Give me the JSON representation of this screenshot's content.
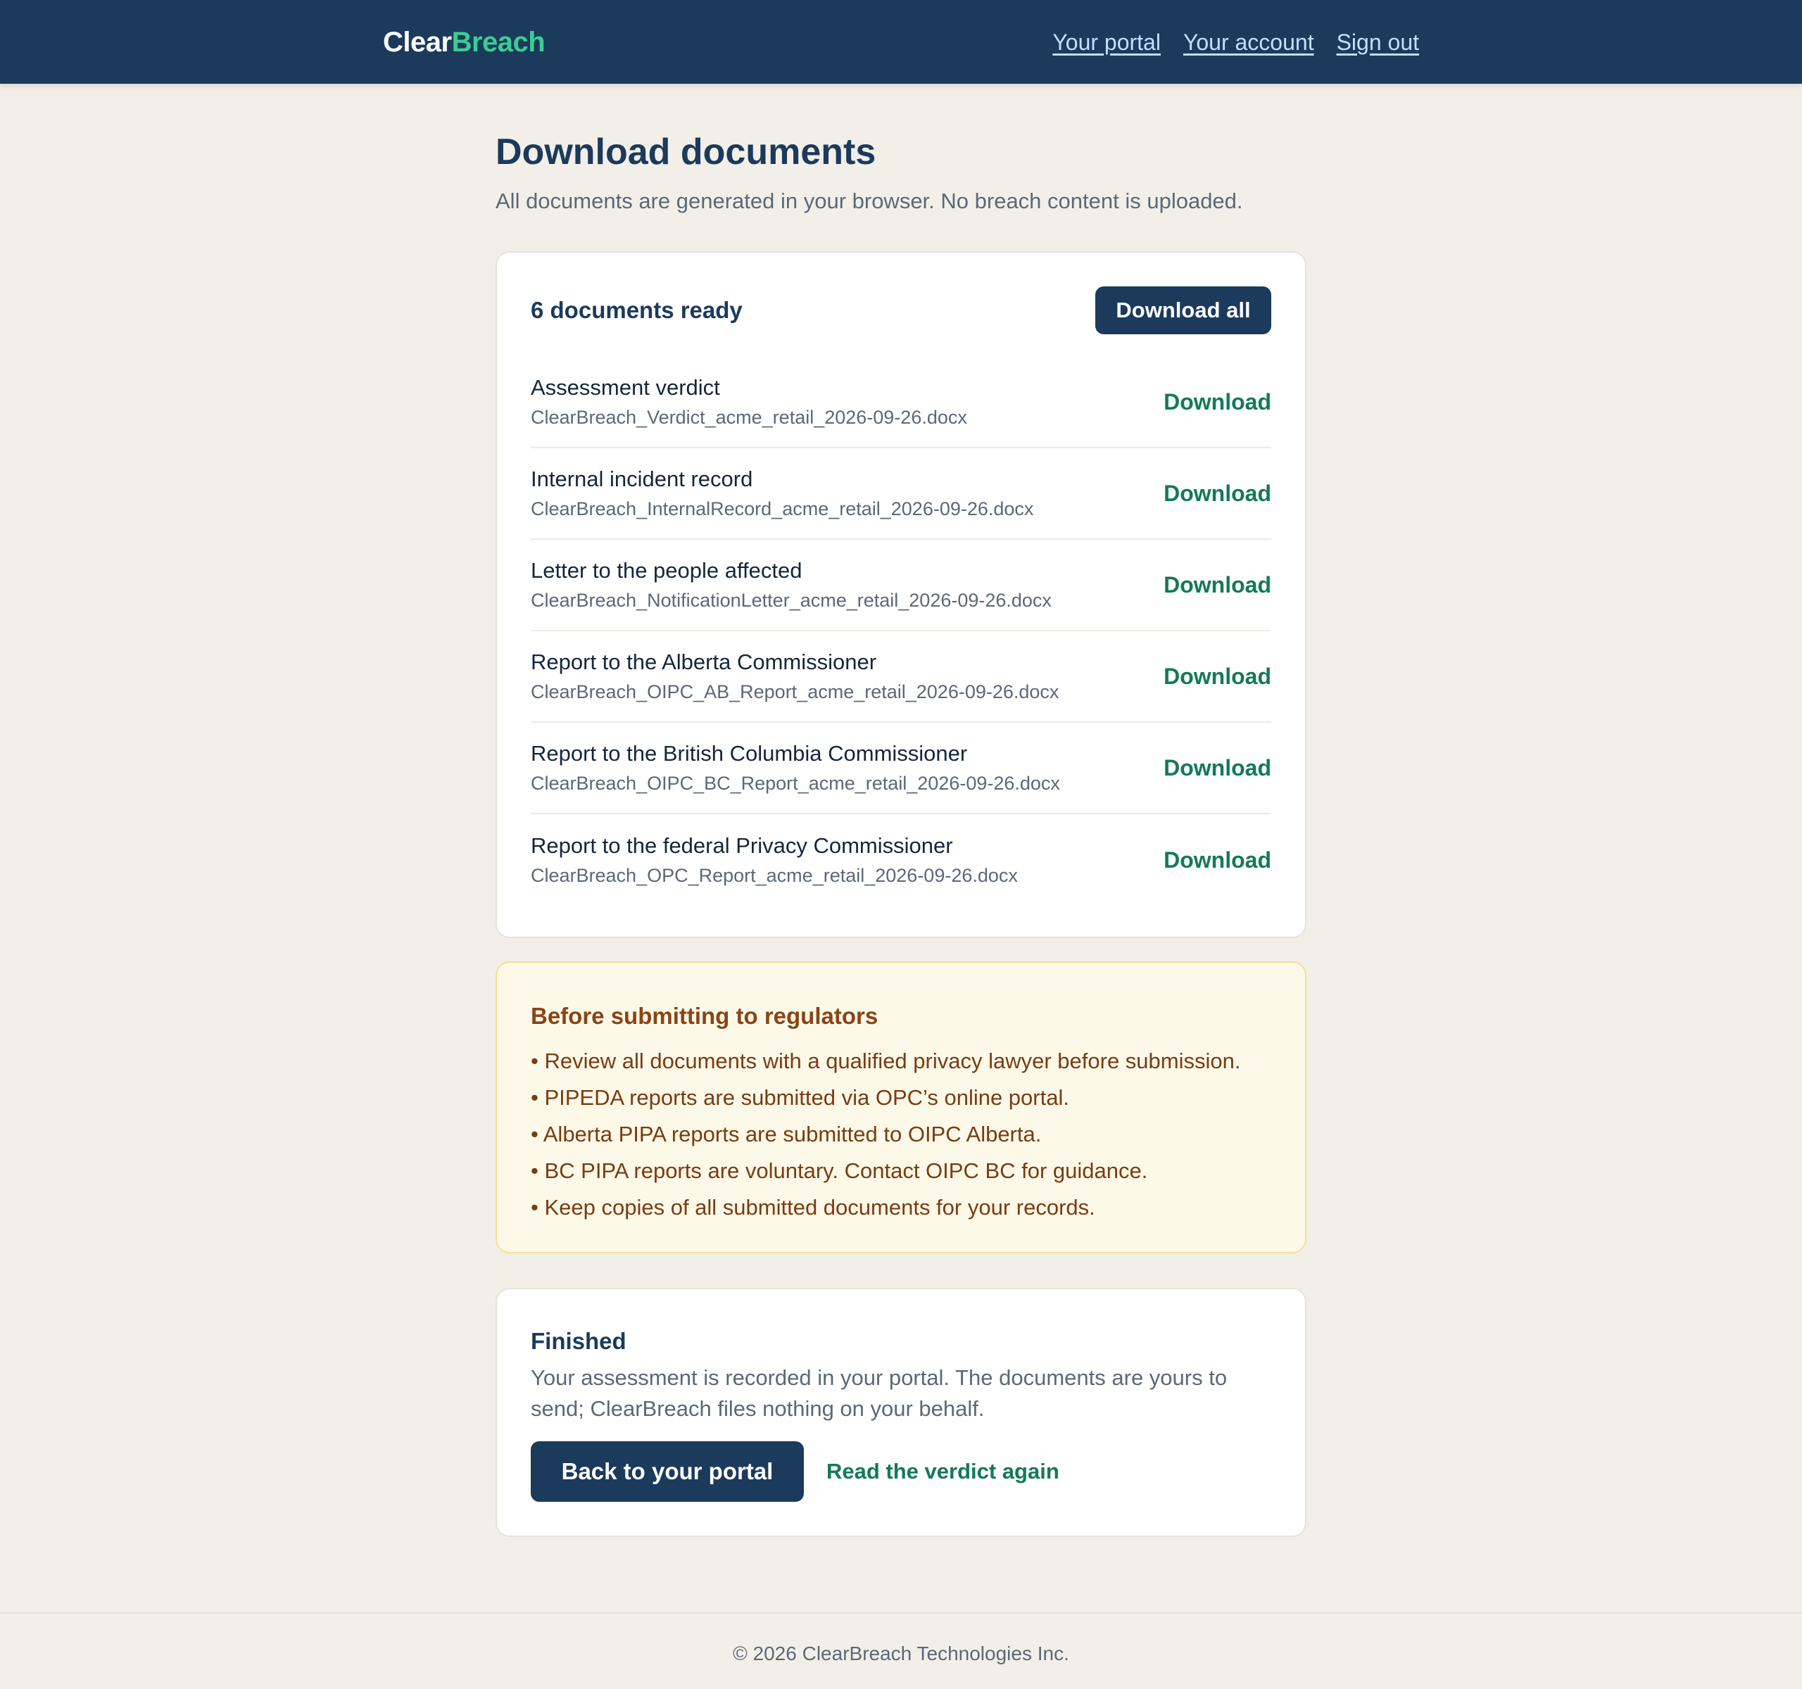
{
  "header": {
    "brand_part1": "Clear",
    "brand_part2": "Breach",
    "nav": [
      "Your portal",
      "Your account",
      "Sign out"
    ]
  },
  "page": {
    "title": "Download documents",
    "subtitle": "All documents are generated in your browser. No breach content is uploaded."
  },
  "documents": {
    "count_label": "6 documents ready",
    "download_all_label": "Download all",
    "items": [
      {
        "title": "Assessment verdict",
        "file": "ClearBreach_Verdict_acme_retail_2026-09-26.docx",
        "action": "Download"
      },
      {
        "title": "Internal incident record",
        "file": "ClearBreach_InternalRecord_acme_retail_2026-09-26.docx",
        "action": "Download"
      },
      {
        "title": "Letter to the people affected",
        "file": "ClearBreach_NotificationLetter_acme_retail_2026-09-26.docx",
        "action": "Download"
      },
      {
        "title": "Report to the Alberta Commissioner",
        "file": "ClearBreach_OIPC_AB_Report_acme_retail_2026-09-26.docx",
        "action": "Download"
      },
      {
        "title": "Report to the British Columbia Commissioner",
        "file": "ClearBreach_OIPC_BC_Report_acme_retail_2026-09-26.docx",
        "action": "Download"
      },
      {
        "title": "Report to the federal Privacy Commissioner",
        "file": "ClearBreach_OPC_Report_acme_retail_2026-09-26.docx",
        "action": "Download"
      }
    ]
  },
  "warning": {
    "title": "Before submitting to regulators",
    "items": [
      "• Review all documents with a qualified privacy lawyer before submission.",
      "• PIPEDA reports are submitted via OPC’s online portal.",
      "• Alberta PIPA reports are submitted to OIPC Alberta.",
      "• BC PIPA reports are voluntary. Contact OIPC BC for guidance.",
      "• Keep copies of all submitted documents for your records."
    ]
  },
  "finished": {
    "title": "Finished",
    "text": "Your assessment is recorded in your portal. The documents are yours to send; ClearBreach files nothing on your behalf.",
    "primary_button": "Back to your portal",
    "secondary_link": "Read the verdict again"
  },
  "footer": {
    "text": "© 2026 ClearBreach Technologies Inc."
  },
  "colors": {
    "navy": "#1b3a5c",
    "brand_green": "#3dcc91",
    "link_green": "#147a55",
    "page_bg": "#f2efe9",
    "warning_bg": "#fdf9e8",
    "warning_text": "#7a3b12"
  }
}
